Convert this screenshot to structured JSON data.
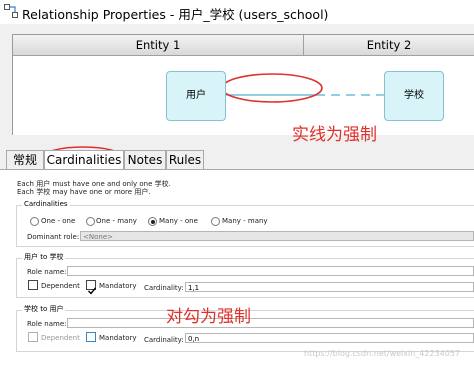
{
  "window": {
    "title": "Relationship Properties - 用户_学校 (users_school)"
  },
  "diagram": {
    "entity1_header": "Entity 1",
    "entity2_header": "Entity 2",
    "entity_a": "用户",
    "entity_b": "学校",
    "annotation_top": "实线为强制"
  },
  "tabs": [
    {
      "label": "常规",
      "active": false
    },
    {
      "label": "Cardinalities",
      "active": true
    },
    {
      "label": "Notes",
      "active": false
    },
    {
      "label": "Rules",
      "active": false
    }
  ],
  "cardinalities_tab": {
    "description_line1": "Each 用户 must have one and only one 学校.",
    "description_line2": "Each 学校 may have one or more 用户.",
    "cardinalities_group": {
      "title": "Cardinalities",
      "options": [
        {
          "label": "One - one",
          "selected": false
        },
        {
          "label": "One - many",
          "selected": false
        },
        {
          "label": "Many - one",
          "selected": true
        },
        {
          "label": "Many - many",
          "selected": false
        }
      ],
      "dominant_role_label": "Dominant role:",
      "dominant_role_value": "<None>"
    },
    "role_a_to_b": {
      "title": "用户 to 学校",
      "role_name_label": "Role name:",
      "role_name_value": "",
      "dependent_label": "Dependent",
      "dependent_checked": false,
      "mandatory_label": "Mandatory",
      "mandatory_checked": true,
      "cardinality_label": "Cardinality:",
      "cardinality_value": "1,1"
    },
    "role_b_to_a": {
      "title": "学校 to 用户",
      "role_name_label": "Role name:",
      "role_name_value": "",
      "dependent_label": "Dependent",
      "dependent_checked": false,
      "mandatory_label": "Mandatory",
      "mandatory_checked": false,
      "cardinality_label": "Cardinality:",
      "cardinality_value": "0,n"
    },
    "annotation_bottom": "对勾为强制"
  },
  "watermark": "https://blog.csdn.net/weixin_42234057",
  "colors": {
    "entity_fill": "#d8f4f8",
    "entity_border": "#86c1cf",
    "relationship_line": "#6cc1d6",
    "annotation_red": "#e0302a",
    "checkbox_blue": "#3d84c7"
  }
}
